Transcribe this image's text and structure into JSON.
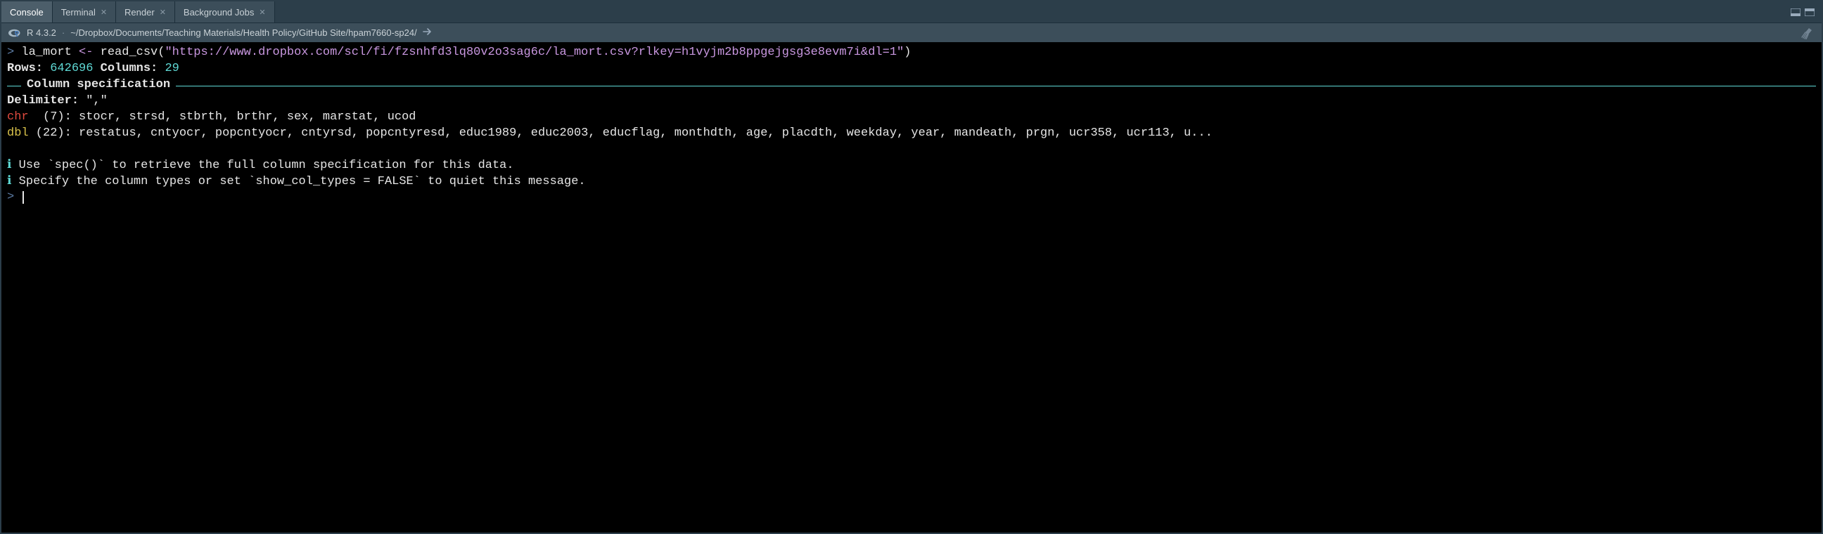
{
  "tabs": {
    "console": "Console",
    "terminal": "Terminal",
    "render": "Render",
    "bgjobs": "Background Jobs"
  },
  "info": {
    "r_version": "R 4.3.2",
    "sep": "·",
    "path": "~/Dropbox/Documents/Teaching Materials/Health Policy/GitHub Site/hpam7660-sp24/"
  },
  "console": {
    "prompt": ">",
    "cmd_var": "la_mort ",
    "cmd_assign": "<-",
    "cmd_func": " read_csv(",
    "cmd_str": "\"https://www.dropbox.com/scl/fi/fzsnhfd3lq80v2o3sag6c/la_mort.csv?rlkey=h1vyjm2b8ppgejgsg3e8evm7i&dl=1\"",
    "cmd_close": ")",
    "rows_label": "Rows: ",
    "rows_val": "642696",
    "cols_label": " Columns: ",
    "cols_val": "29",
    "colspec_label": "Column specification",
    "delim_label": "Delimiter: ",
    "delim_val": "\",\"",
    "chr_label": "chr",
    "chr_count": "  (7): ",
    "chr_cols": "stocr, strsd, stbrth, brthr, sex, marstat, ucod",
    "dbl_label": "dbl",
    "dbl_count": " (22): ",
    "dbl_cols": "restatus, cntyocr, popcntyocr, cntyrsd, popcntyresd, educ1989, educ2003, educflag, monthdth, age, placdth, weekday, year, mandeath, prgn, ucr358, ucr113, u...",
    "info_i": "ℹ",
    "tip1": " Use `spec()` to retrieve the full column specification for this data.",
    "tip2": " Specify the column types or set `show_col_types = FALSE` to quiet this message."
  }
}
